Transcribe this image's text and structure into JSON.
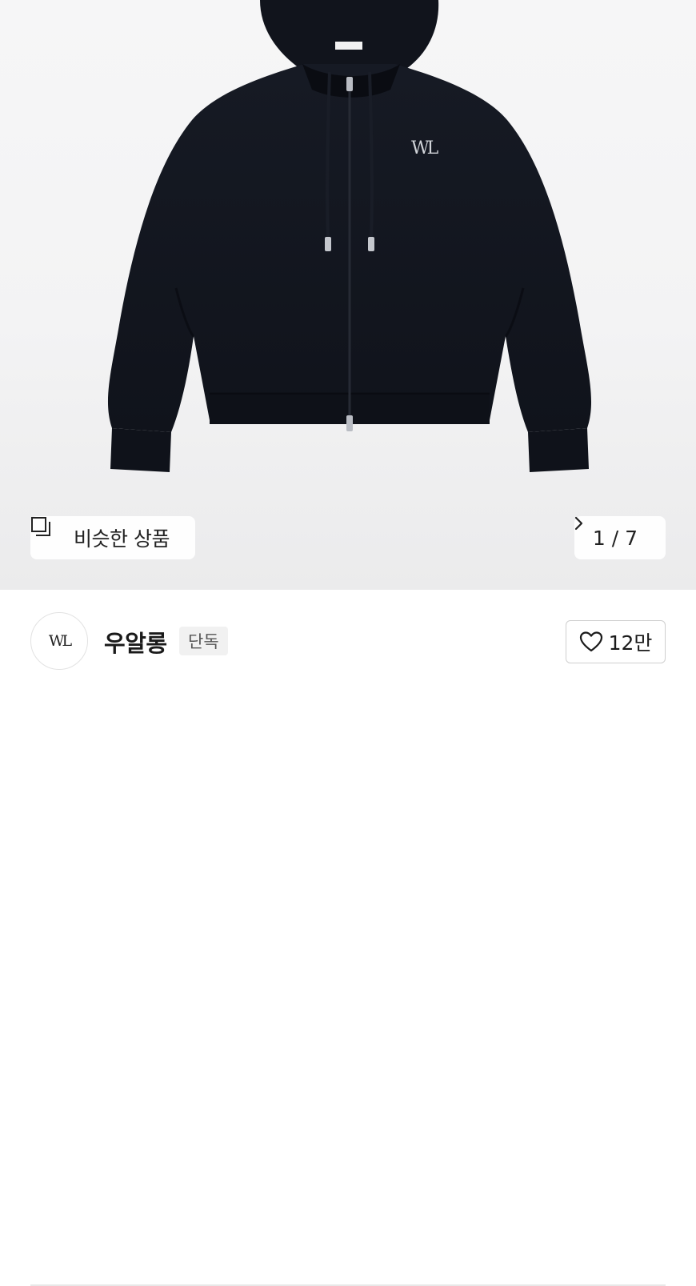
{
  "gallery": {
    "similar_label": "비슷한 상품",
    "page_indicator": "1 / 7"
  },
  "product_image": {
    "subject": "black zip-up hoodie",
    "logo_text": "WL"
  },
  "seller": {
    "name": "우알롱",
    "badge": "단독",
    "avatar_text": "WL"
  },
  "like": {
    "count": "12만"
  },
  "icons": {
    "similar": "copy-icon",
    "pager": "chevron-right-icon",
    "like": "heart-icon"
  },
  "colors": {
    "hoodie": "#131722",
    "text": "#222222",
    "badge_bg": "#f1f1f1"
  }
}
